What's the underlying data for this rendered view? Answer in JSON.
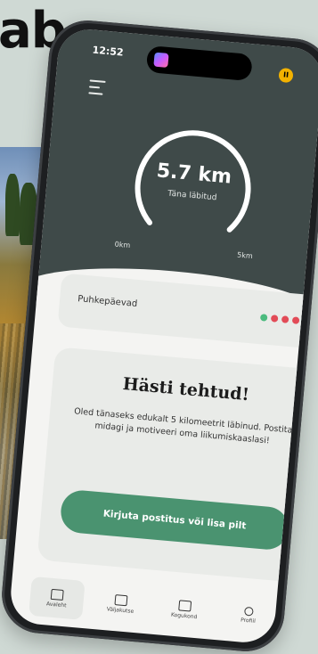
{
  "background": {
    "heading_fragment": "ab"
  },
  "status_bar": {
    "time": "12:52",
    "pause_glyph": "II"
  },
  "activity": {
    "distance": "5.7 km",
    "caption": "Täna läbitud",
    "min_label": "0km",
    "max_label": "5km",
    "progress_fraction": 1.0
  },
  "streak": {
    "label": "Puhkepäevad",
    "dots": [
      "#4bbb7e",
      "#e24b57",
      "#e24b57",
      "#e24b57",
      "#e24b57",
      "#e24b57"
    ]
  },
  "message": {
    "title": "Hästi tehtud!",
    "body": "Oled tänaseks edukalt 5 kilomeetrit läbinud. Postita midagi ja motiveeri oma liikumiskaaslasi!",
    "button": "Kirjuta postitus või lisa pilt"
  },
  "nav": [
    {
      "label": "Avaleht",
      "icon": "home-icon"
    },
    {
      "label": "Väljakutse",
      "icon": "challenge-icon"
    },
    {
      "label": "Kogukond",
      "icon": "community-icon"
    },
    {
      "label": "Profiil",
      "icon": "profile-icon"
    }
  ],
  "colors": {
    "header": "#3f4a49",
    "accent": "#4a9370",
    "card": "#e9ebe8"
  }
}
